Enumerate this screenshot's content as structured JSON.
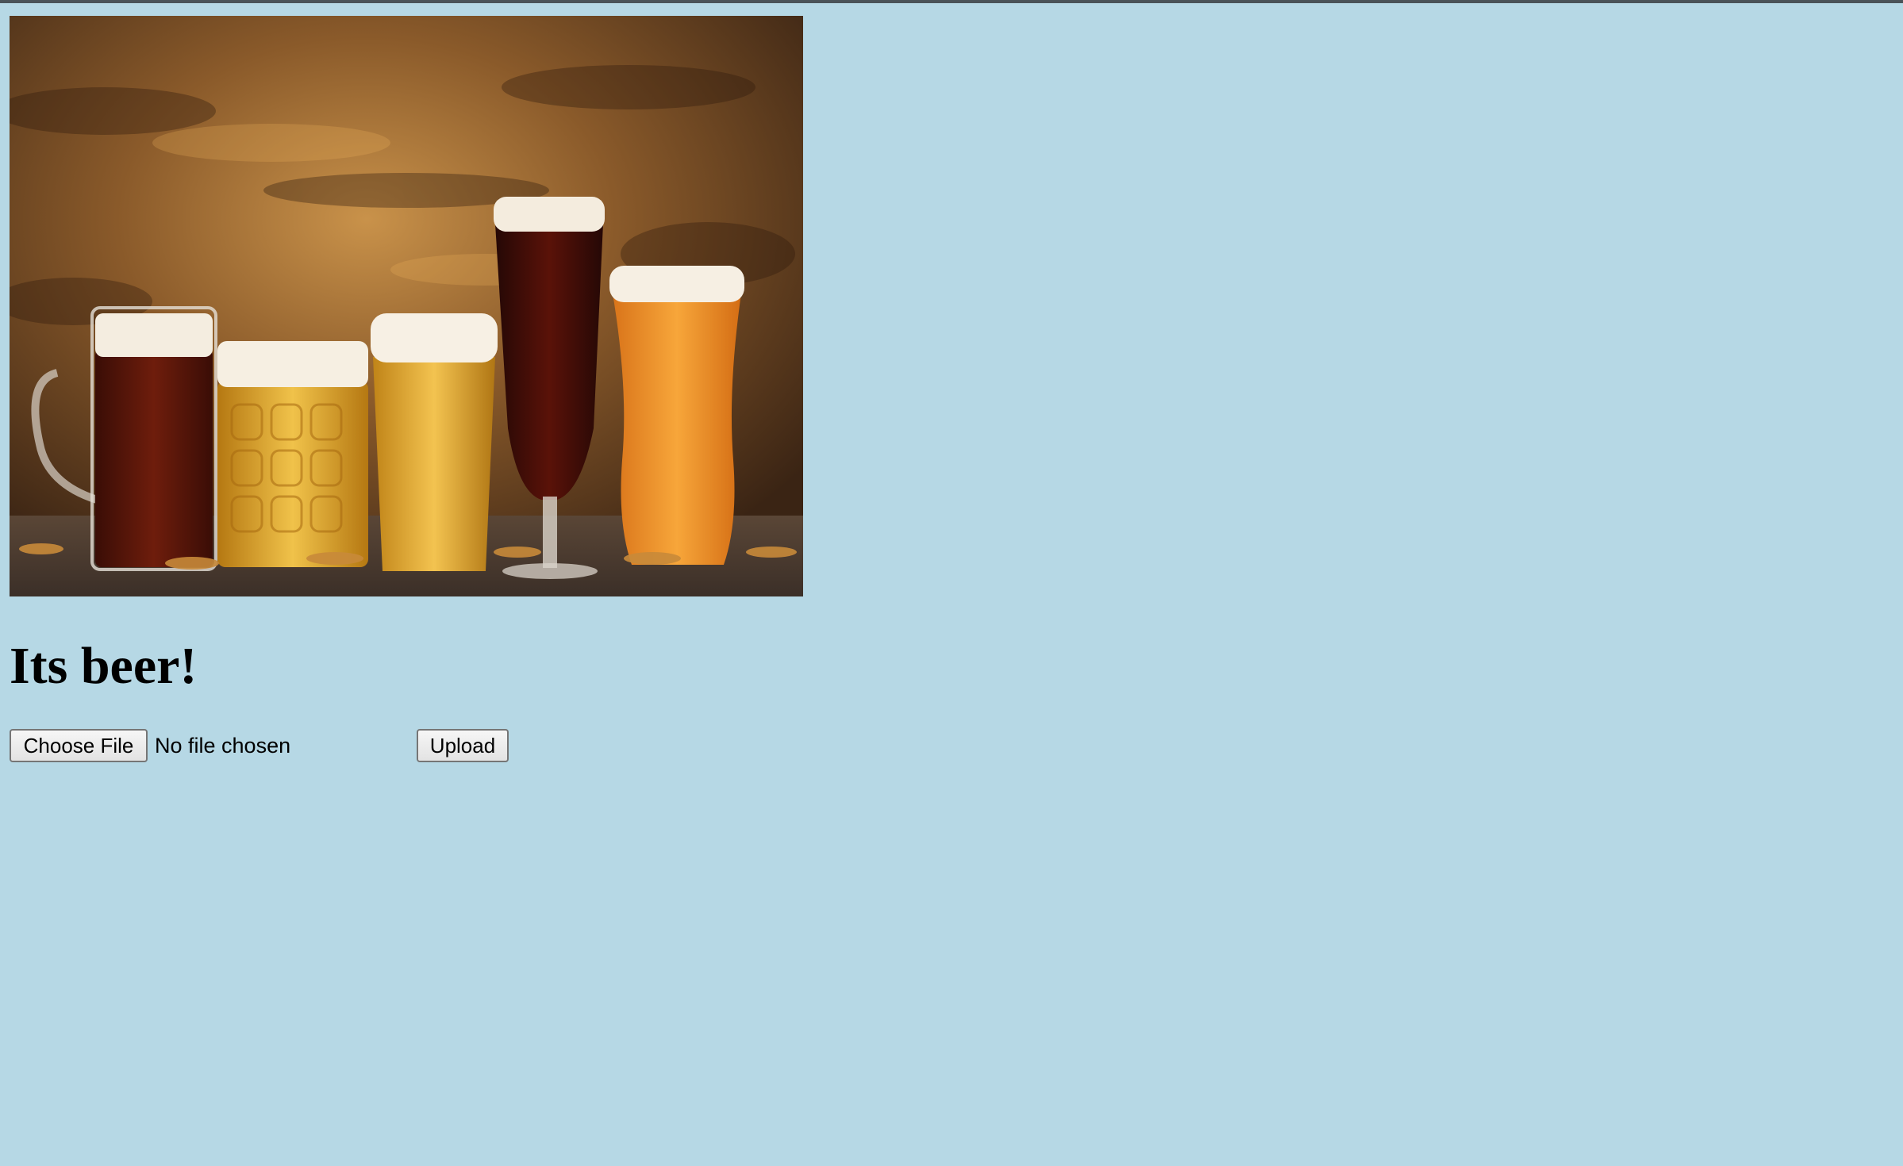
{
  "page": {
    "background": "#b6d8e5",
    "heading": "Its beer!"
  },
  "image": {
    "alt": "Five glasses of different beers on a wooden table"
  },
  "form": {
    "choose_file_label": "Choose File",
    "file_status": "No file chosen",
    "upload_label": "Upload"
  }
}
